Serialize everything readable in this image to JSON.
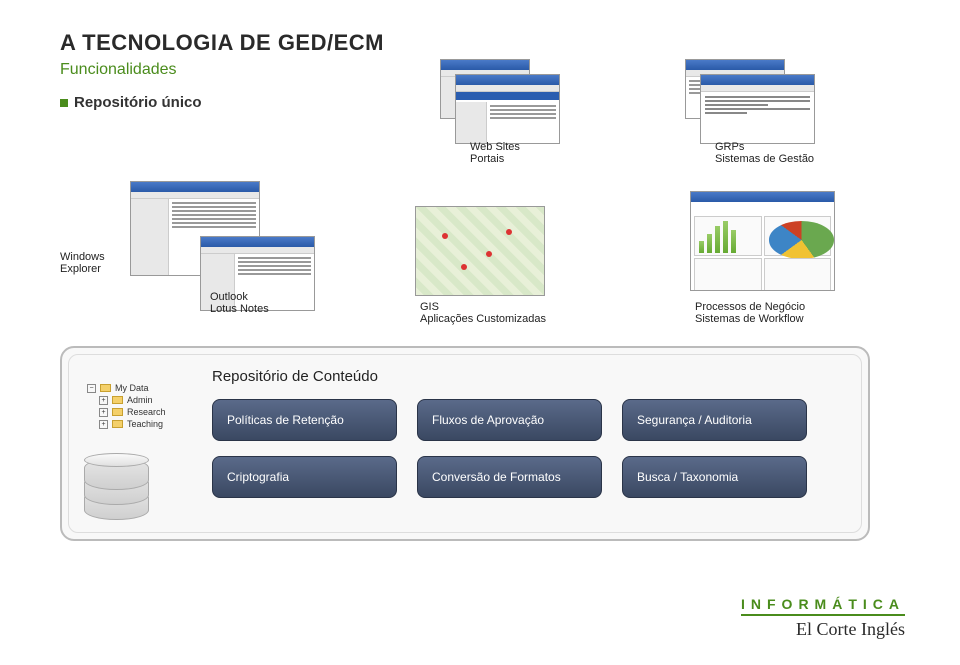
{
  "title": "A TECNOLOGIA DE GED/ECM",
  "subtitle": "Funcionalidades",
  "bullet": "Repositório único",
  "labels": {
    "websites_l1": "Web Sites",
    "websites_l2": "Portais",
    "grps_l1": "GRPs",
    "grps_l2": "Sistemas de Gestão",
    "winexp_l1": "Windows",
    "winexp_l2": "Explorer",
    "outlook_l1": "Outlook",
    "outlook_l2": "Lotus Notes",
    "gis_l1": "GIS",
    "gis_l2": "Aplicações Customizadas",
    "wf_l1": "Processos de Negócio",
    "wf_l2": "Sistemas de Workflow"
  },
  "repo": {
    "title": "Repositório de Conteúdo",
    "tree": {
      "root": "My Data",
      "items": [
        "Admin",
        "Research",
        "Teaching"
      ]
    },
    "boxes": [
      "Políticas de Retenção",
      "Fluxos de Aprovação",
      "Segurança / Auditoria",
      "Criptografia",
      "Conversão de Formatos",
      "Busca / Taxonomia"
    ]
  },
  "footer": {
    "top": "INFORMÁTICA",
    "bottom": "El Corte Inglés"
  }
}
